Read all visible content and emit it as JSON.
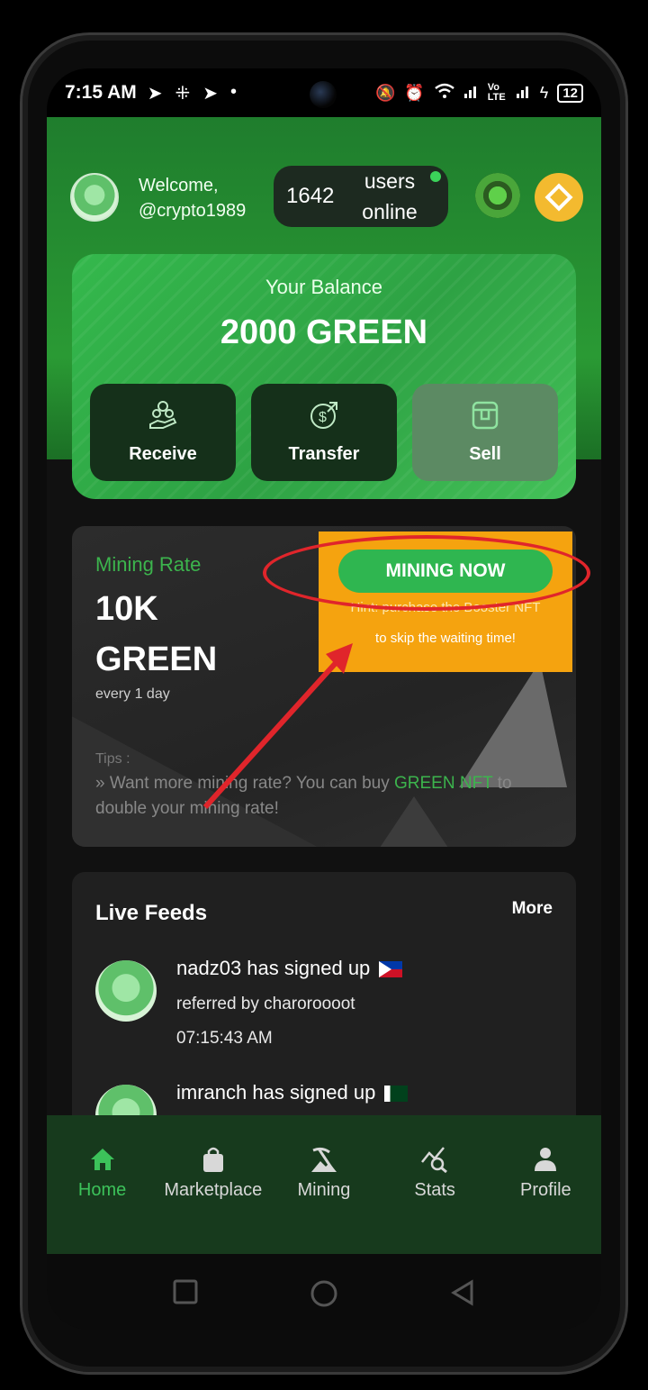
{
  "status_bar": {
    "time": "7:15 AM",
    "left_icons": [
      "telegram-icon",
      "grid-icon",
      "telegram-icon",
      "dot-icon"
    ],
    "right_icons": [
      "mute-icon",
      "alarm-icon",
      "wifi-icon",
      "signal-icon",
      "volte-icon",
      "signal-icon",
      "charging-icon"
    ],
    "volte_label": "Vo LTE",
    "battery": "12"
  },
  "header": {
    "welcome_line1": "Welcome,",
    "welcome_line2": "@crypto1989",
    "online_count": "1642",
    "online_label": "users online"
  },
  "balance": {
    "title": "Your Balance",
    "value": "2000 GREEN",
    "actions": [
      {
        "label": "Receive",
        "icon": "coins-hand-icon"
      },
      {
        "label": "Transfer",
        "icon": "dollar-transfer-icon"
      },
      {
        "label": "Sell",
        "icon": "store-icon"
      }
    ]
  },
  "mining": {
    "label": "Mining Rate",
    "value": "10K GREEN",
    "period": "every 1 day",
    "button": "MINING NOW",
    "boost_line1": "Hint: purchase the Booster NFT",
    "boost_line2": "to skip the waiting time!",
    "tips_label": "Tips :",
    "tips_prefix": "» Want more mining rate? You can buy ",
    "tips_highlight": "GREEN NFT",
    "tips_suffix": " to double your mining rate!"
  },
  "feeds": {
    "title": "Live Feeds",
    "more": "More",
    "items": [
      {
        "text": "nadz03 has signed up",
        "flag": "philippines-flag",
        "referred": "referred by charoroooot",
        "time": "07:15:43 AM"
      },
      {
        "text": "imranch has signed up",
        "flag": "pakistan-flag"
      }
    ]
  },
  "bottom_nav": [
    {
      "label": "Home",
      "icon": "home-icon",
      "active": true
    },
    {
      "label": "Marketplace",
      "icon": "shopping-bag-icon",
      "active": false
    },
    {
      "label": "Mining",
      "icon": "mining-icon",
      "active": false
    },
    {
      "label": "Stats",
      "icon": "stats-icon",
      "active": false
    },
    {
      "label": "Profile",
      "icon": "profile-icon",
      "active": false
    }
  ],
  "colors": {
    "accent_green": "#3cb44d",
    "header_green": "#2a9a34",
    "orange": "#f5a30f",
    "annotation_red": "#e0252b"
  }
}
